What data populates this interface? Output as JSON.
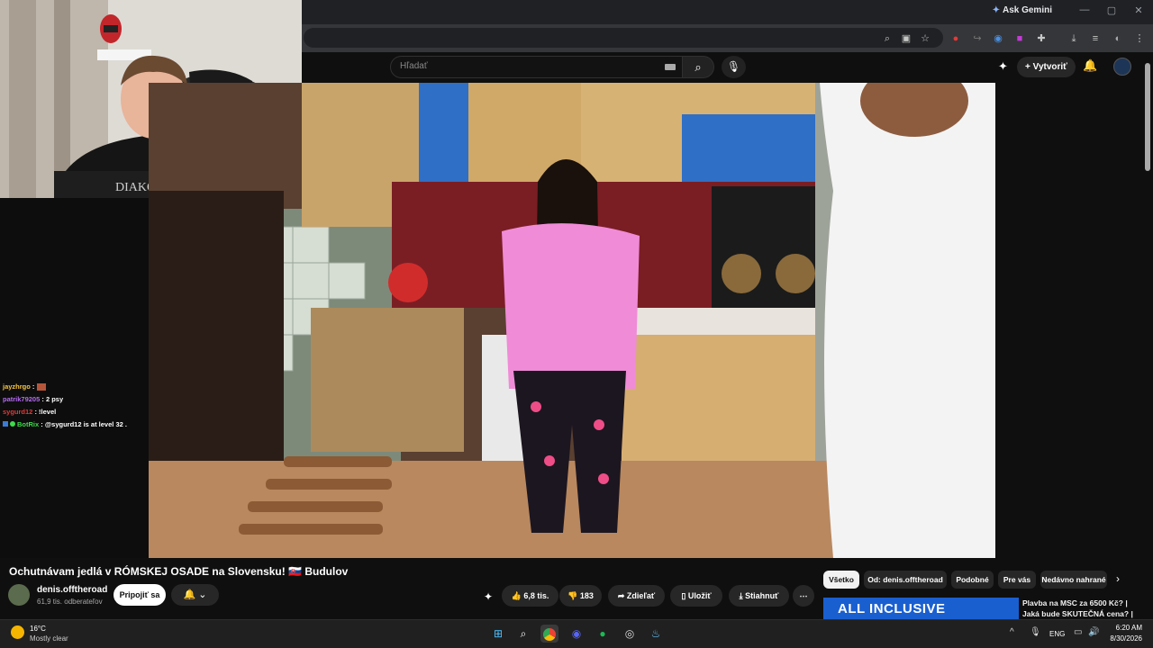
{
  "browser": {
    "ask_gemini": "Ask Gemini"
  },
  "youtube": {
    "search_placeholder": "Hľadať",
    "create_label": "Vytvoriť"
  },
  "chat": [
    {
      "user": "jayzhrgo",
      "msg": "",
      "color": "#f5c542"
    },
    {
      "user": "patrik79205",
      "msg": "2 psy",
      "color": "#b46cf0"
    },
    {
      "user": "sygurd12",
      "msg": "!level",
      "color": "#e23b3b"
    },
    {
      "user": "BotRix",
      "msg": "@sygurd12 is at level 32 .",
      "color": "#3ddc4a"
    }
  ],
  "video": {
    "title": "Ochutnávam jedlá v RÓMSKEJ OSADE na Slovensku! 🇸🇰 Budulov",
    "channel_name": "denis.offtheroad",
    "subscribers": "61,9 tis. odberateľov",
    "join_label": "Pripojiť sa",
    "likes": "6,8 tis.",
    "dislikes": "183",
    "share_label": "Zdieľať",
    "save_label": "Uložiť",
    "download_label": "Stiahnuť"
  },
  "chips": [
    {
      "label": "Všetko",
      "active": true
    },
    {
      "label": "Od: denis.offtheroad",
      "active": false
    },
    {
      "label": "Podobné",
      "active": false
    },
    {
      "label": "Pre vás",
      "active": false
    },
    {
      "label": "Nedávno nahrané",
      "active": false
    }
  ],
  "recommended": {
    "thumb_text": "ALL INCLUSIVE",
    "title_line1": "Plavba na MSC za 6500 Kč? |",
    "title_line2": "Jaká bude SKUTEČNÁ cena? |"
  },
  "taskbar": {
    "temperature": "16°C",
    "condition": "Mostly clear",
    "language": "ENG",
    "time": "6:20 AM",
    "date": "8/30/2026"
  }
}
